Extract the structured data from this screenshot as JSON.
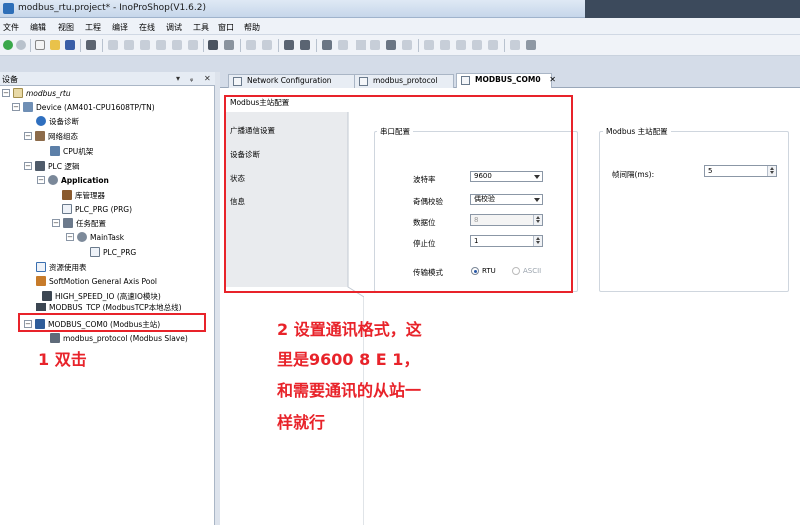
{
  "window": {
    "title": "modbus_rtu.project* - InoProShop(V1.6.2)"
  },
  "menu": [
    "文件",
    "编辑",
    "视图",
    "工程",
    "编译",
    "在线",
    "调试",
    "工具",
    "窗口",
    "帮助"
  ],
  "device_panel": {
    "title": "设备",
    "controls": [
      "▾",
      "ᵩ",
      "✕"
    ],
    "tree": [
      {
        "label": "modbus_rtu",
        "style": "italic"
      },
      {
        "label": "Device (AM401-CPU1608TP/TN)"
      },
      {
        "label": "设备诊断"
      },
      {
        "label": "网络组态"
      },
      {
        "label": "CPU机架"
      },
      {
        "label": "PLC 逻辑"
      },
      {
        "label": "Application",
        "style": "bold"
      },
      {
        "label": "库管理器"
      },
      {
        "label": "PLC_PRG (PRG)"
      },
      {
        "label": "任务配置"
      },
      {
        "label": "MainTask"
      },
      {
        "label": "PLC_PRG"
      },
      {
        "label": "资源使用表"
      },
      {
        "label": "SoftMotion General Axis Pool"
      },
      {
        "label": "HIGH_SPEED_IO (高速IO模块)"
      },
      {
        "label": "MODBUS_TCP (ModbusTCP本地总线)"
      },
      {
        "label": "MODBUS_COM0 (Modbus主站)"
      },
      {
        "label": "modbus_protocol (Modbus Slave)"
      }
    ]
  },
  "tabs": [
    {
      "label": "Network Configuration"
    },
    {
      "label": "modbus_protocol"
    },
    {
      "label": "MODBUS_COM0",
      "close": "✕",
      "active": true
    }
  ],
  "editor": {
    "config_title": "Modbus主站配置",
    "nav": [
      "广播通信设置",
      "设备诊断",
      "状态",
      "信息"
    ],
    "serial": {
      "title": "串口配置",
      "baud_label": "波特率",
      "baud_value": "9600",
      "parity_label": "奇偶校验",
      "parity_value": "偶校验",
      "databits_label": "数据位",
      "databits_value": "8",
      "stopbits_label": "停止位",
      "stopbits_value": "1",
      "mode_label": "传输模式",
      "mode_options": [
        "RTU",
        "ASCII"
      ],
      "mode_selected": "RTU"
    },
    "master": {
      "title": "Modbus 主站配置",
      "interval_label": "帧间隔(ms):",
      "interval_value": "5"
    }
  },
  "annotations": {
    "step1": "1 双击",
    "step2_lines": [
      "2 设置通讯格式，这",
      "里是9600 8 E 1，",
      "和需要通讯的从站一",
      "样就行"
    ]
  },
  "colors": {
    "annotation_red": "#e8232a",
    "accent_blue": "#2e6fb8"
  }
}
